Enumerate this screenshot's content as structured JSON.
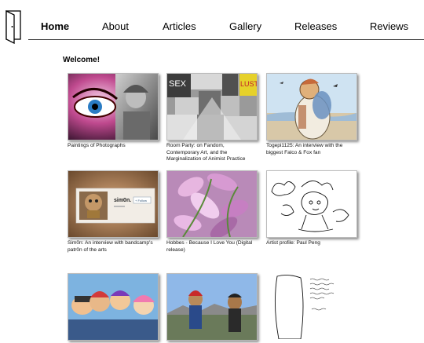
{
  "nav": {
    "items": [
      {
        "label": "Home",
        "active": true
      },
      {
        "label": "About"
      },
      {
        "label": "Articles"
      },
      {
        "label": "Gallery"
      },
      {
        "label": "Releases"
      },
      {
        "label": "Reviews"
      }
    ]
  },
  "main": {
    "heading": "Welcome!",
    "posts": [
      {
        "caption": "Paintings of Photographs"
      },
      {
        "caption": "Room Party: on Fandom, Contemporary Art, and the Marginalization of Animist Practice",
        "thumb_text_1": "SEX",
        "thumb_text_2": "LUST"
      },
      {
        "caption": "Togepi1125: An interview with the biggest Falco & Fox fan"
      },
      {
        "caption": "Sim0n: An interview with bandcamp's patr0n of the arts",
        "thumb_profile_name": "sim0n.",
        "thumb_button": "+ Follow"
      },
      {
        "caption": "Hobbes - Because I Love You (Digital release)"
      },
      {
        "caption": "Artist profile: Paul Peng"
      },
      {
        "caption": ""
      },
      {
        "caption": ""
      },
      {
        "caption": ""
      }
    ]
  }
}
